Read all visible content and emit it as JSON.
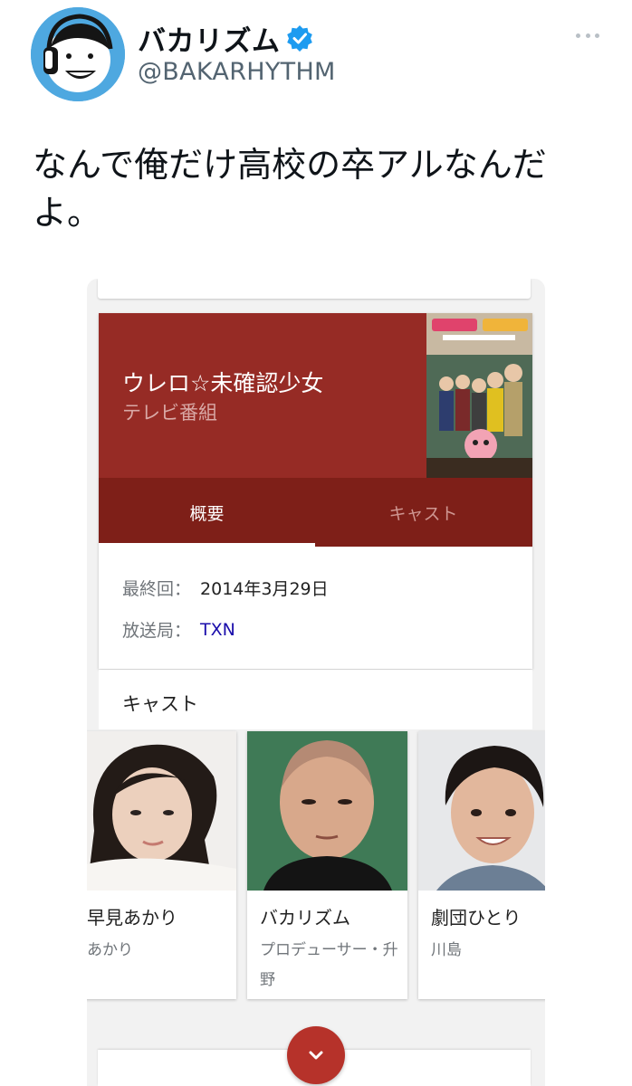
{
  "tweet": {
    "display_name": "バカリズム",
    "handle": "@BAKARHYTHM",
    "verified": true,
    "text": "なんで俺だけ高校の卒アルなんだよ。",
    "avatar_icon": "avatar-headphones-face-icon",
    "more_icon": "more-options-icon"
  },
  "card": {
    "title": "ウレロ☆未確認少女",
    "subtitle": "テレビ番組",
    "tabs": [
      {
        "label": "概要",
        "active": true
      },
      {
        "label": "キャスト",
        "active": false
      }
    ],
    "info": [
      {
        "label": "最終回：",
        "value": "2014年3月29日",
        "is_link": false
      },
      {
        "label": "放送局：",
        "value": "TXN",
        "is_link": true
      }
    ],
    "cast_heading": "キャスト",
    "cast": [
      {
        "name": "早見あかり",
        "role": "あかり"
      },
      {
        "name": "バカリズム",
        "role": "プロデューサー・升野"
      },
      {
        "name": "劇団ひとり",
        "role": "川島"
      }
    ],
    "expand_icon": "chevron-down-icon"
  },
  "colors": {
    "hero": "#962b25",
    "tabs": "#7e1f18",
    "expand_button": "#b6322a",
    "verified": "#1d9bf0",
    "link": "#1a0dab"
  }
}
